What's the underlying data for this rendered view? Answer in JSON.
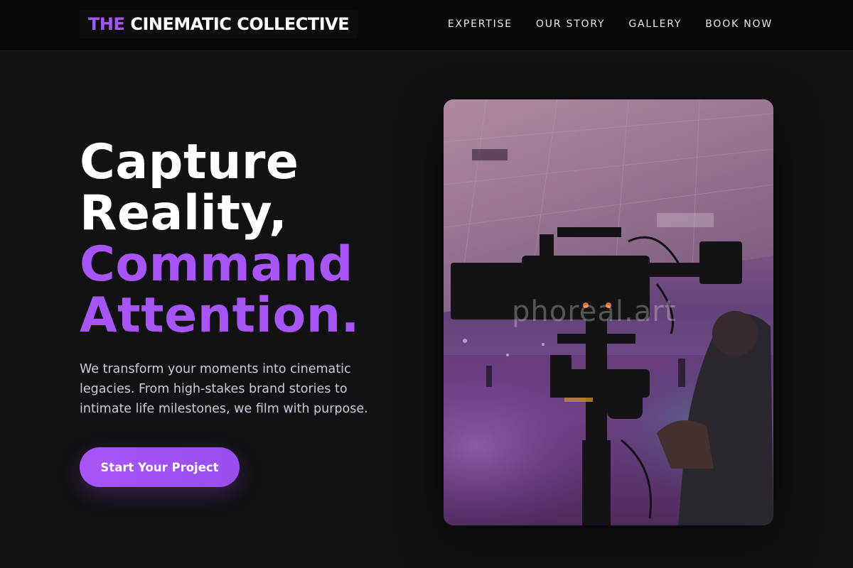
{
  "header": {
    "brand_accent": "THE",
    "brand_rest": "CINEMATIC COLLECTIVE",
    "nav": [
      {
        "label": "EXPERTISE"
      },
      {
        "label": "OUR STORY"
      },
      {
        "label": "GALLERY"
      },
      {
        "label": "BOOK NOW"
      }
    ]
  },
  "hero": {
    "title_line1": "Capture",
    "title_line2": "Reality,",
    "title_line3": "Command",
    "title_line4": "Attention.",
    "description": "We transform your moments into cinematic legacies. From high-stakes brand stories to intimate life milestones, we film with purpose.",
    "cta_label": "Start Your Project",
    "image_watermark": "phoreal.art"
  },
  "colors": {
    "accent": "#a855f7",
    "background": "#121113",
    "nav_background": "#080808"
  }
}
